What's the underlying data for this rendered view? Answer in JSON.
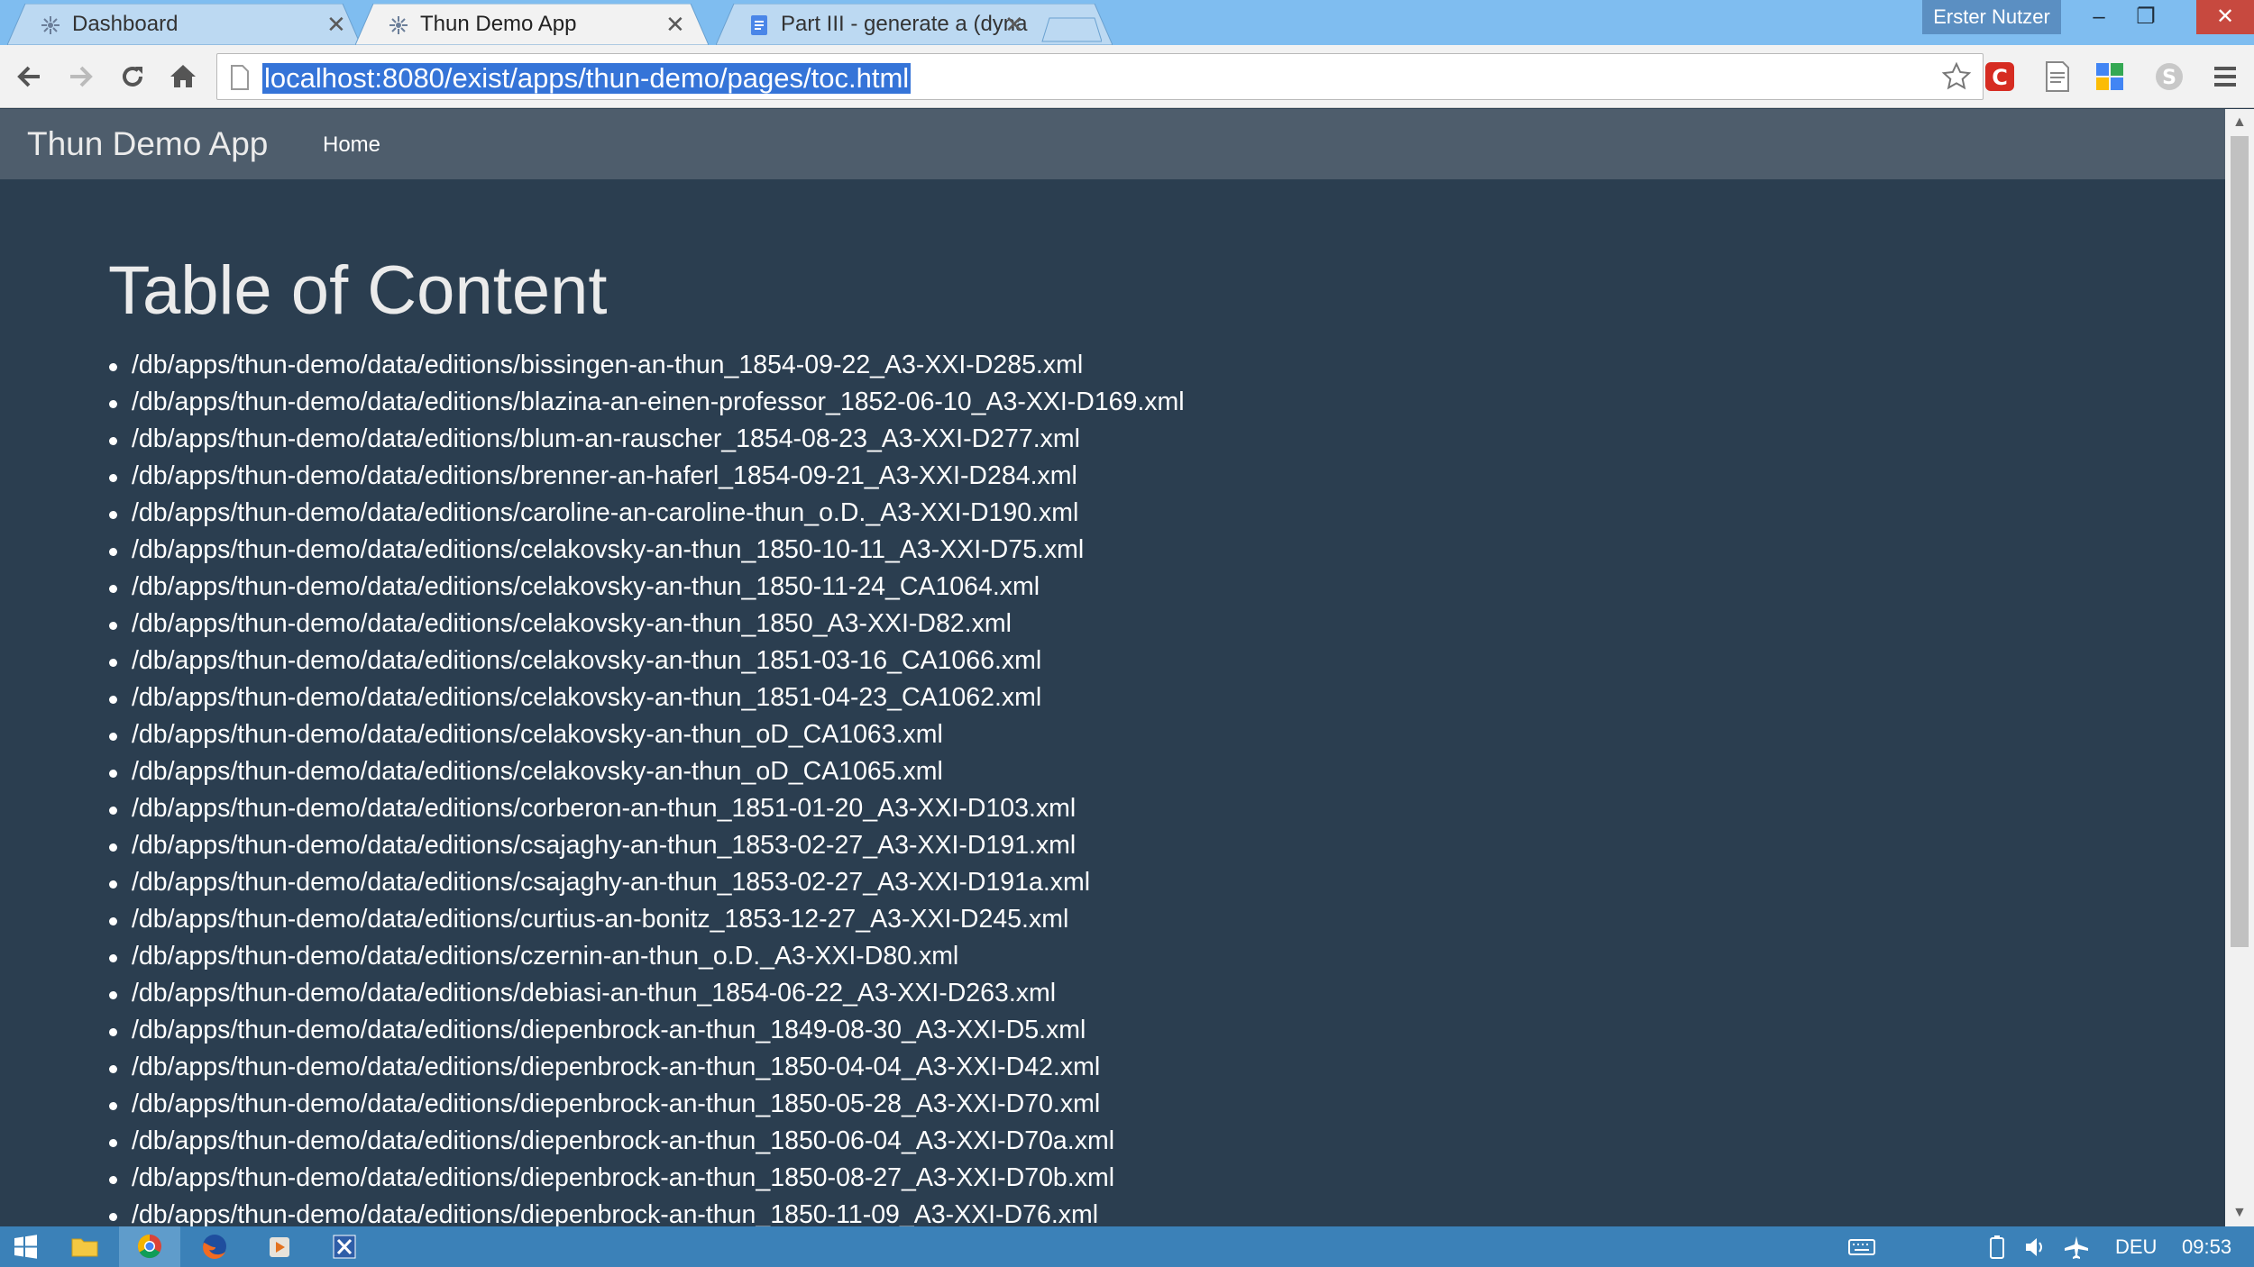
{
  "colors": {
    "titlebar": "#7fbdf0",
    "navbar": "#4e5d6c",
    "page_background": "#2b3e50",
    "url_selection": "#3574d8",
    "taskbar": "#3b81b8"
  },
  "browser": {
    "tabs": [
      {
        "title": "Dashboard",
        "icon": "exist-db-icon",
        "active": false
      },
      {
        "title": "Thun Demo App",
        "icon": "exist-db-icon",
        "active": true
      },
      {
        "title": "Part III - generate a (dyna",
        "icon": "google-docs-icon",
        "active": false
      }
    ],
    "user_name": "Erster Nutzer",
    "window_controls": {
      "minimize": "–",
      "restore": "❐",
      "close": "✕"
    },
    "address": "localhost:8080/exist/apps/thun-demo/pages/toc.html",
    "extensions": [
      "c-extension-icon",
      "page-extension-icon",
      "puzzle-extension-icon",
      "skype-extension-icon"
    ]
  },
  "app": {
    "brand": "Thun Demo App",
    "nav": [
      "Home"
    ]
  },
  "page": {
    "title": "Table of Content",
    "items": [
      "/db/apps/thun-demo/data/editions/bissingen-an-thun_1854-09-22_A3-XXI-D285.xml",
      "/db/apps/thun-demo/data/editions/blazina-an-einen-professor_1852-06-10_A3-XXI-D169.xml",
      "/db/apps/thun-demo/data/editions/blum-an-rauscher_1854-08-23_A3-XXI-D277.xml",
      "/db/apps/thun-demo/data/editions/brenner-an-haferl_1854-09-21_A3-XXI-D284.xml",
      "/db/apps/thun-demo/data/editions/caroline-an-caroline-thun_o.D._A3-XXI-D190.xml",
      "/db/apps/thun-demo/data/editions/celakovsky-an-thun_1850-10-11_A3-XXI-D75.xml",
      "/db/apps/thun-demo/data/editions/celakovsky-an-thun_1850-11-24_CA1064.xml",
      "/db/apps/thun-demo/data/editions/celakovsky-an-thun_1850_A3-XXI-D82.xml",
      "/db/apps/thun-demo/data/editions/celakovsky-an-thun_1851-03-16_CA1066.xml",
      "/db/apps/thun-demo/data/editions/celakovsky-an-thun_1851-04-23_CA1062.xml",
      "/db/apps/thun-demo/data/editions/celakovsky-an-thun_oD_CA1063.xml",
      "/db/apps/thun-demo/data/editions/celakovsky-an-thun_oD_CA1065.xml",
      "/db/apps/thun-demo/data/editions/corberon-an-thun_1851-01-20_A3-XXI-D103.xml",
      "/db/apps/thun-demo/data/editions/csajaghy-an-thun_1853-02-27_A3-XXI-D191.xml",
      "/db/apps/thun-demo/data/editions/csajaghy-an-thun_1853-02-27_A3-XXI-D191a.xml",
      "/db/apps/thun-demo/data/editions/curtius-an-bonitz_1853-12-27_A3-XXI-D245.xml",
      "/db/apps/thun-demo/data/editions/czernin-an-thun_o.D._A3-XXI-D80.xml",
      "/db/apps/thun-demo/data/editions/debiasi-an-thun_1854-06-22_A3-XXI-D263.xml",
      "/db/apps/thun-demo/data/editions/diepenbrock-an-thun_1849-08-30_A3-XXI-D5.xml",
      "/db/apps/thun-demo/data/editions/diepenbrock-an-thun_1850-04-04_A3-XXI-D42.xml",
      "/db/apps/thun-demo/data/editions/diepenbrock-an-thun_1850-05-28_A3-XXI-D70.xml",
      "/db/apps/thun-demo/data/editions/diepenbrock-an-thun_1850-06-04_A3-XXI-D70a.xml",
      "/db/apps/thun-demo/data/editions/diepenbrock-an-thun_1850-08-27_A3-XXI-D70b.xml",
      "/db/apps/thun-demo/data/editions/diepenbrock-an-thun_1850-11-09_A3-XXI-D76.xml"
    ]
  },
  "taskbar": {
    "apps": [
      "windows-start-icon",
      "file-explorer-icon",
      "chrome-icon",
      "firefox-icon",
      "media-player-icon",
      "xml-editor-icon"
    ],
    "language": "DEU",
    "time": "09:53"
  }
}
